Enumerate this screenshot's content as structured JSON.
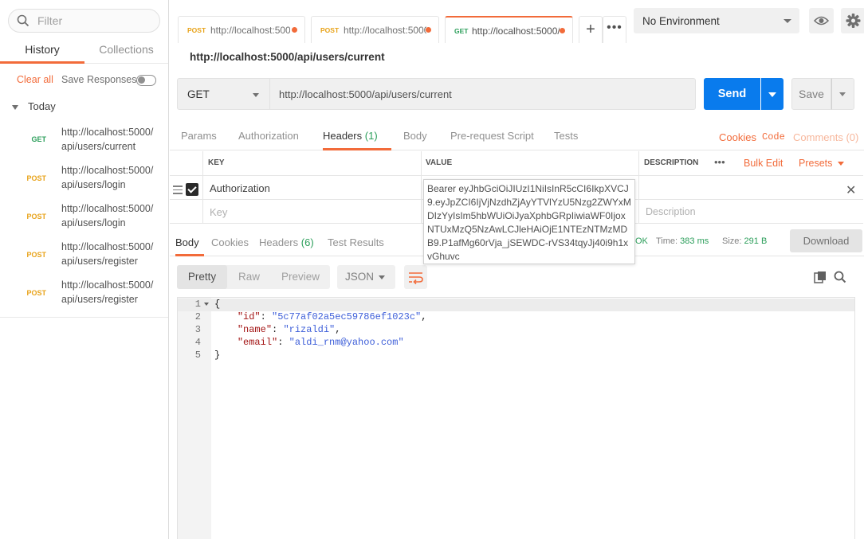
{
  "sidebar": {
    "filter_placeholder": "Filter",
    "tabs": {
      "history": "History",
      "collections": "Collections"
    },
    "clear_all": "Clear all",
    "save_responses": "Save Responses",
    "group_label": "Today",
    "items": [
      {
        "method": "GET",
        "url_line1": "http://localhost:5000/",
        "url_line2": "api/users/current"
      },
      {
        "method": "POST",
        "url_line1": "http://localhost:5000/",
        "url_line2": "api/users/login"
      },
      {
        "method": "POST",
        "url_line1": "http://localhost:5000/",
        "url_line2": "api/users/login"
      },
      {
        "method": "POST",
        "url_line1": "http://localhost:5000/",
        "url_line2": "api/users/register"
      },
      {
        "method": "POST",
        "url_line1": "http://localhost:5000/",
        "url_line2": "api/users/register"
      }
    ]
  },
  "tabs": [
    {
      "method": "POST",
      "url": "http://localhost:5000"
    },
    {
      "method": "POST",
      "url": "http://localhost:5000"
    },
    {
      "method": "GET",
      "url": "http://localhost:5000/"
    }
  ],
  "environment": {
    "selected": "No Environment"
  },
  "request": {
    "title": "http://localhost:5000/api/users/current",
    "method": "GET",
    "url": "http://localhost:5000/api/users/current",
    "send_label": "Send",
    "save_label": "Save",
    "subtabs": {
      "params": "Params",
      "authorization": "Authorization",
      "headers": "Headers",
      "headers_count": "(1)",
      "body": "Body",
      "prerequest": "Pre-request Script",
      "tests": "Tests"
    },
    "links": {
      "cookies": "Cookies",
      "code": "Code",
      "comments": "Comments (0)"
    }
  },
  "headers_table": {
    "col_key": "KEY",
    "col_value": "VALUE",
    "col_description": "DESCRIPTION",
    "more": "•••",
    "bulk_edit": "Bulk Edit",
    "presets": "Presets",
    "rows": [
      {
        "key": "Authorization",
        "value": "Bearer eyJhbGciOiJIUzI1NiIsInR5cCI6IkpXVCJ9.eyJpZCI6IjVjNzdhZjAyYTVlYzU5Nzg2ZWYxMDIzYyIsIm5hbWUiOiJyaXphbGRpIiwiaWF0IjoxNTUxMzQ5NzAwLCJleHAiOjE1NTEzNTMzMDB9.P1afMg60rVja_jSEWDC-rVS34tqyJj40i9h1xvGhuvc"
      }
    ],
    "placeholder_key": "Key",
    "placeholder_description": "Description"
  },
  "response": {
    "tabs": {
      "body": "Body",
      "cookies": "Cookies",
      "headers": "Headers",
      "headers_count": "(6)",
      "test_results": "Test Results"
    },
    "status": "OK",
    "time_label": "Time:",
    "time_value": "383 ms",
    "size_label": "Size:",
    "size_value": "291 B",
    "download": "Download",
    "formats": {
      "pretty": "Pretty",
      "raw": "Raw",
      "preview": "Preview"
    },
    "language": "JSON",
    "lines": [
      "1",
      "2",
      "3",
      "4",
      "5"
    ],
    "json": {
      "id_key": "\"id\"",
      "id_val": "\"5c77af02a5ec59786ef1023c\"",
      "name_key": "\"name\"",
      "name_val": "\"rizaldi\"",
      "email_key": "\"email\"",
      "email_val": "\"aldi_rnm@yahoo.com\""
    }
  },
  "colors": {
    "accent": "#f26b3a",
    "send": "#097bed",
    "get": "#2b9e5a",
    "post": "#e8a31a"
  }
}
